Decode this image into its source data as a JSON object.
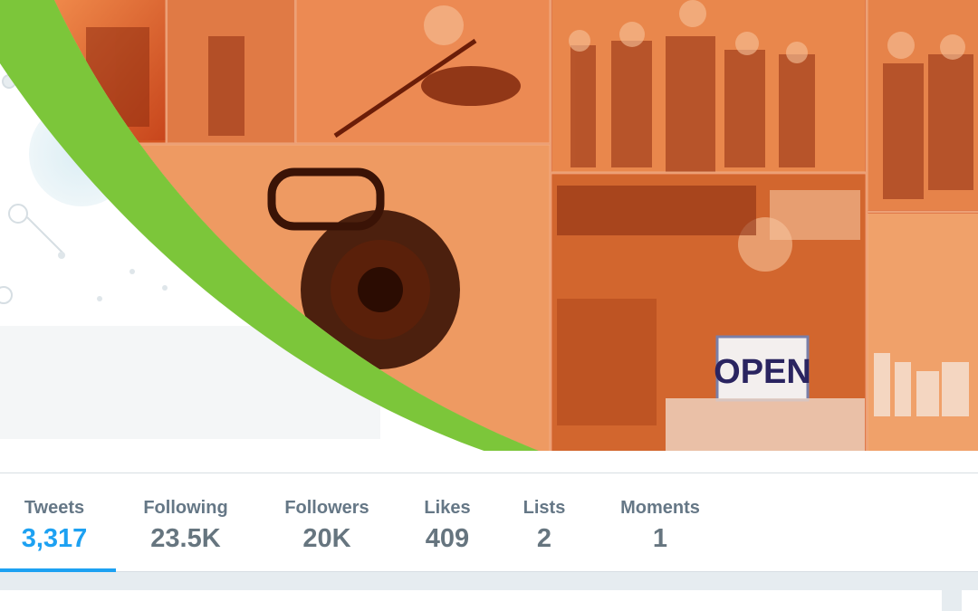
{
  "banner": {
    "curve_color": "#7cc63a",
    "photo_tint": "#e2622a",
    "sign_text": "OPEN"
  },
  "nav": {
    "accent_color": "#1da1f2",
    "stats": [
      {
        "label": "Tweets",
        "value": "3,317",
        "active": true
      },
      {
        "label": "Following",
        "value": "23.5K",
        "active": false
      },
      {
        "label": "Followers",
        "value": "20K",
        "active": false
      },
      {
        "label": "Likes",
        "value": "409",
        "active": false
      },
      {
        "label": "Lists",
        "value": "2",
        "active": false
      },
      {
        "label": "Moments",
        "value": "1",
        "active": false
      }
    ]
  }
}
